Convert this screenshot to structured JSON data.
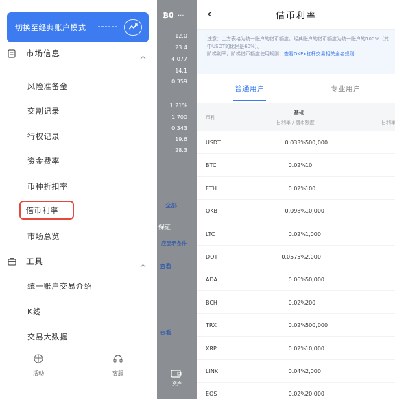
{
  "drawer": {
    "mode_button_label": "切换至经典账户模式",
    "market_section": "市场信息",
    "market_items": [
      "风险准备金",
      "交割记录",
      "行权记录",
      "资金费率",
      "币种折扣率",
      "借币利率",
      "市场总览"
    ],
    "tools_section": "工具",
    "tools_items": [
      "统一账户交易介绍",
      "K线",
      "交易大数据"
    ],
    "bottom_nav": [
      "活动",
      "客服"
    ]
  },
  "strip": {
    "header_symbol": "₿0",
    "header_more": "···",
    "numbers": [
      "12.0",
      "23.4",
      "4.077",
      "14.1",
      "0.359",
      "1.21%",
      "1.700",
      "0.343",
      "19.6",
      "28.3"
    ],
    "all_label": "全部",
    "margin_label": "保证",
    "details_label": "应显示条件",
    "links": [
      "查看",
      "查看"
    ],
    "asset_label": "资产"
  },
  "panel": {
    "title": "借币利率",
    "back_glyph": "‹",
    "notice_text": "注意：上方表格为统一账户的借币额度。经典账户的借币额度为统一账户的100%（其中USDT的比例是60%）。",
    "notice_text2": "阶梯利率，阶梯借币额度使用规则：",
    "notice_link": "查看OKEx杠杆交易相关全名规则",
    "tabs": [
      "普通用户",
      "专业用户"
    ],
    "col_currency": "币种",
    "col_base": "基础",
    "col_rate_quota": "日利率 / 借币额度",
    "col_rate_next": "日利率"
  },
  "chart_data": {
    "type": "table",
    "columns": [
      "币种",
      "日利率",
      "借币额度"
    ],
    "rows": [
      [
        "USDT",
        "0.033%",
        "500,000"
      ],
      [
        "BTC",
        "0.02%",
        "10"
      ],
      [
        "ETH",
        "0.02%",
        "100"
      ],
      [
        "OKB",
        "0.098%",
        "10,000"
      ],
      [
        "LTC",
        "0.02%",
        "1,000"
      ],
      [
        "DOT",
        "0.0575%",
        "2,000"
      ],
      [
        "ADA",
        "0.06%",
        "50,000"
      ],
      [
        "BCH",
        "0.02%",
        "200"
      ],
      [
        "TRX",
        "0.02%",
        "500,000"
      ],
      [
        "XRP",
        "0.02%",
        "10,000"
      ],
      [
        "LINK",
        "0.04%",
        "2,000"
      ],
      [
        "EOS",
        "0.02%",
        "20,000"
      ]
    ]
  }
}
